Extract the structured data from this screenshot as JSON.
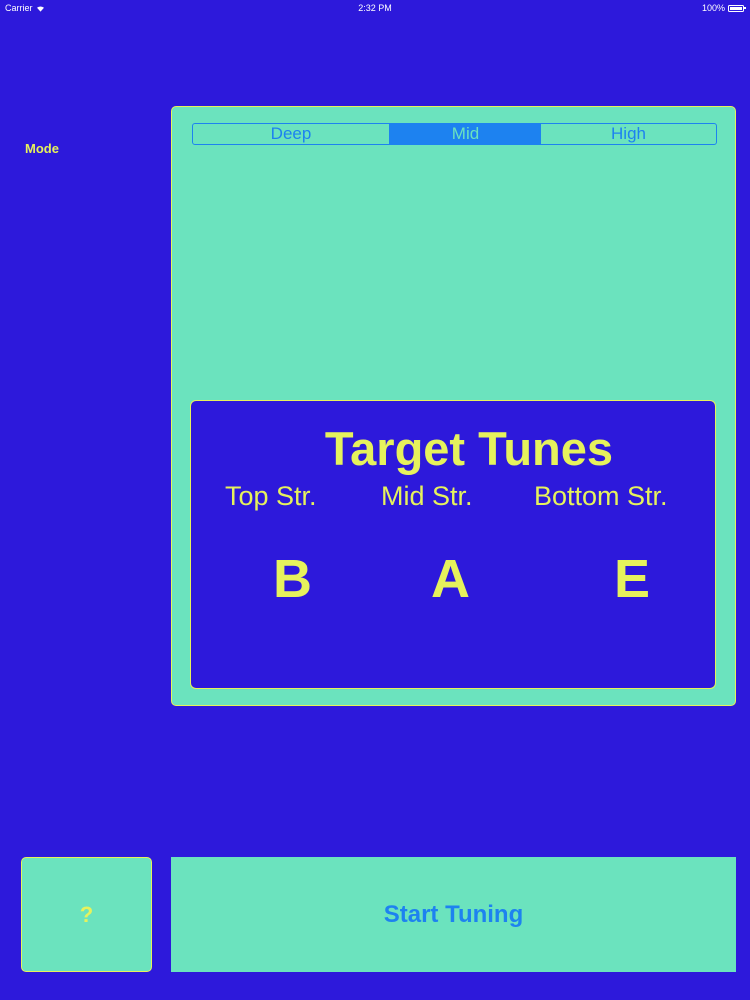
{
  "status_bar": {
    "carrier": "Carrier",
    "time": "2:32 PM",
    "battery": "100%"
  },
  "mode": {
    "label": "Mode",
    "segments": [
      "Deep",
      "Mid",
      "High"
    ],
    "selected": "Mid"
  },
  "target": {
    "title": "Target Tunes",
    "strings": [
      {
        "label": "Top Str.",
        "note": "B"
      },
      {
        "label": "Mid Str.",
        "note": "A"
      },
      {
        "label": "Bottom Str.",
        "note": "E"
      }
    ]
  },
  "buttons": {
    "help": "?",
    "start": "Start Tuning"
  },
  "colors": {
    "background": "#2D19DB",
    "panel": "#6BE3BE",
    "accent_yellow": "#E6F25C",
    "accent_blue": "#1D82F0"
  }
}
